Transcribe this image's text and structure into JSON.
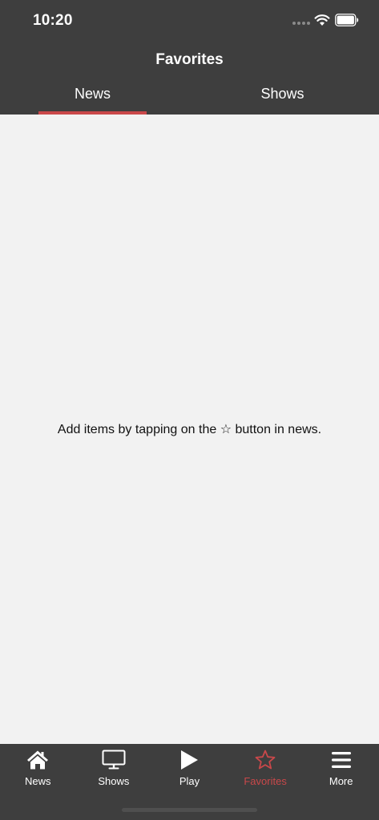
{
  "status_bar": {
    "time": "10:20"
  },
  "header": {
    "title": "Favorites",
    "tabs": [
      {
        "label": "News",
        "selected": true
      },
      {
        "label": "Shows",
        "selected": false
      }
    ]
  },
  "content": {
    "empty_message": "Add items by tapping on the ☆ button in news."
  },
  "tab_bar": {
    "items": [
      {
        "label": "News",
        "icon": "home-icon",
        "active": false
      },
      {
        "label": "Shows",
        "icon": "monitor-icon",
        "active": false
      },
      {
        "label": "Play",
        "icon": "play-icon",
        "active": false
      },
      {
        "label": "Favorites",
        "icon": "star-icon",
        "active": true
      },
      {
        "label": "More",
        "icon": "menu-icon",
        "active": false
      }
    ]
  },
  "colors": {
    "header_background": "#3e3e3e",
    "content_background": "#f2f2f2",
    "accent": "#c9484a",
    "text_light": "#ffffff"
  }
}
